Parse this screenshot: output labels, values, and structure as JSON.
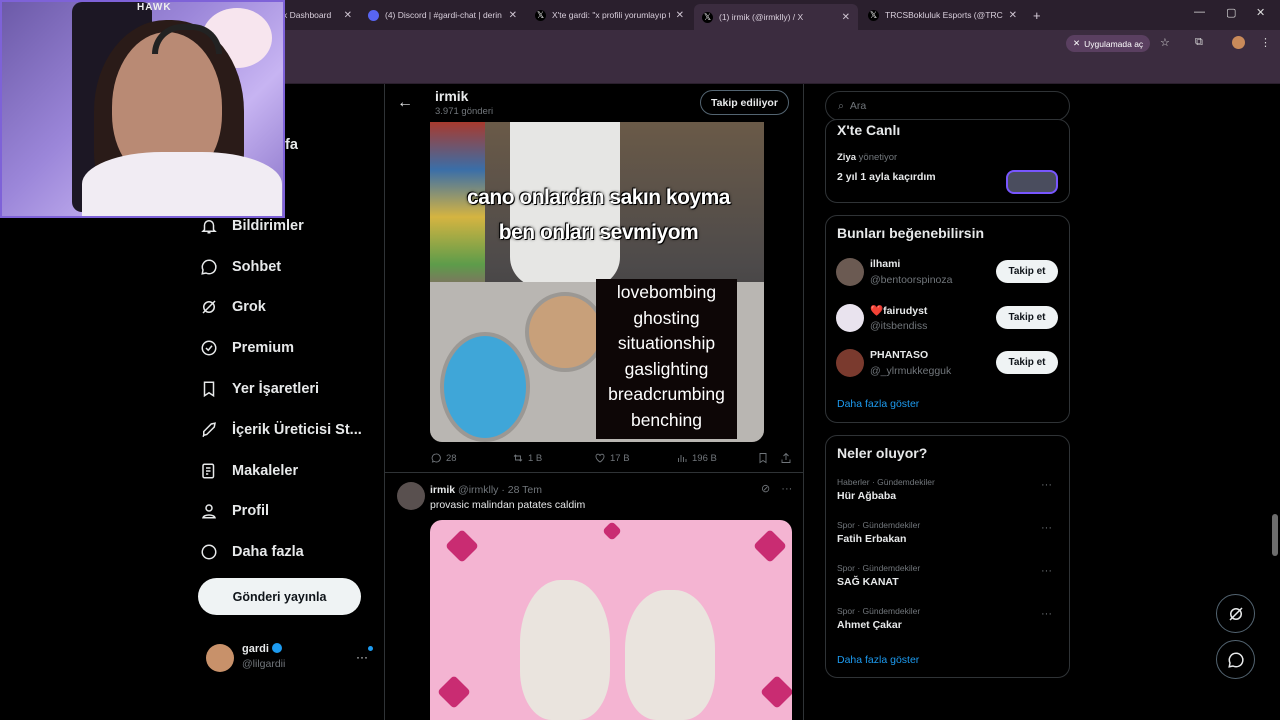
{
  "browser": {
    "tabs": [
      {
        "label": "k Dashboard",
        "color": "#e8a83a"
      },
      {
        "label": "(4) Discord | #gardi-chat | derin co",
        "color": "#5865f2"
      },
      {
        "label": "X'te gardi: \"x profili yorumlayıp tik",
        "color": "#ffffff"
      },
      {
        "label": "(1) irmik (@irmklly) / X",
        "color": "#ffffff"
      },
      {
        "label": "TRCSBokluluk Esports (@TRCSEsp",
        "color": "#ffffff"
      }
    ],
    "new_tab": "+",
    "install_label": "Uygulamada aç",
    "window_controls": [
      "—",
      "▢",
      "✕"
    ]
  },
  "webcam": {
    "logo": "HAWK"
  },
  "sidebar": {
    "partial_label": "fa",
    "items": [
      {
        "label": "Bildirimler",
        "icon": "bell-icon"
      },
      {
        "label": "Sohbet",
        "icon": "chat-icon"
      },
      {
        "label": "Grok",
        "icon": "grok-icon"
      },
      {
        "label": "Premium",
        "icon": "premium-icon"
      },
      {
        "label": "Yer İşaretleri",
        "icon": "bookmark-icon"
      },
      {
        "label": "İçerik Üreticisi St...",
        "icon": "rocket-icon"
      },
      {
        "label": "Makaleler",
        "icon": "article-icon"
      },
      {
        "label": "Profil",
        "icon": "profile-icon"
      },
      {
        "label": "Daha fazla",
        "icon": "more-circle-icon"
      }
    ],
    "post_button": "Gönderi yayınla",
    "account": {
      "name": "gardi",
      "handle": "@lilgardii",
      "more": "···"
    }
  },
  "profile_header": {
    "name": "irmik",
    "post_count": "3.971 gönderi",
    "follow_label": "Takip ediliyor"
  },
  "tweet1": {
    "caption_top": [
      "cano onlardan sakın koyma",
      "ben onları sevmiyom"
    ],
    "caption_box": [
      "lovebombing",
      "ghosting",
      "situationship",
      "gaslighting",
      "breadcrumbing",
      "benching"
    ],
    "replies": "28",
    "retweets": "1 B",
    "likes": "17 B",
    "views": "196 B"
  },
  "tweet2": {
    "name": "irmik",
    "handle": "@irmklly",
    "date": "· 28 Tem",
    "text": "provasic malindan patates caldim",
    "more": "···"
  },
  "search": {
    "placeholder": "Ara"
  },
  "live": {
    "title": "X'te Canlı",
    "host": "Ziya",
    "host_suffix": "yönetiyor",
    "text": "2 yıl 1 ayla kaçırdım"
  },
  "suggestions": {
    "title": "Bunları beğenebilirsin",
    "users": [
      {
        "name": "ilhami",
        "handle": "@bentoorspinoza",
        "button": "Takip et",
        "color": "#6b5a52"
      },
      {
        "name": "❤️fairudyst",
        "handle": "@itsbendiss",
        "button": "Takip et",
        "color": "#e9e3ee"
      },
      {
        "name": "PHANTASO",
        "handle": "@_ylrmukkegguk",
        "button": "Takip et",
        "color": "#7a3a2e"
      }
    ],
    "more": "Daha fazla göster"
  },
  "trends": {
    "title": "Neler oluyor?",
    "items": [
      {
        "category": "Haberler · Gündemdekiler",
        "name": "Hür Ağbaba"
      },
      {
        "category": "Spor · Gündemdekiler",
        "name": "Fatih Erbakan"
      },
      {
        "category": "Spor · Gündemdekiler",
        "name": "SAĞ KANAT"
      },
      {
        "category": "Spor · Gündemdekiler",
        "name": "Ahmet Çakar"
      }
    ],
    "more": "Daha fazla göster",
    "dots": "···"
  }
}
